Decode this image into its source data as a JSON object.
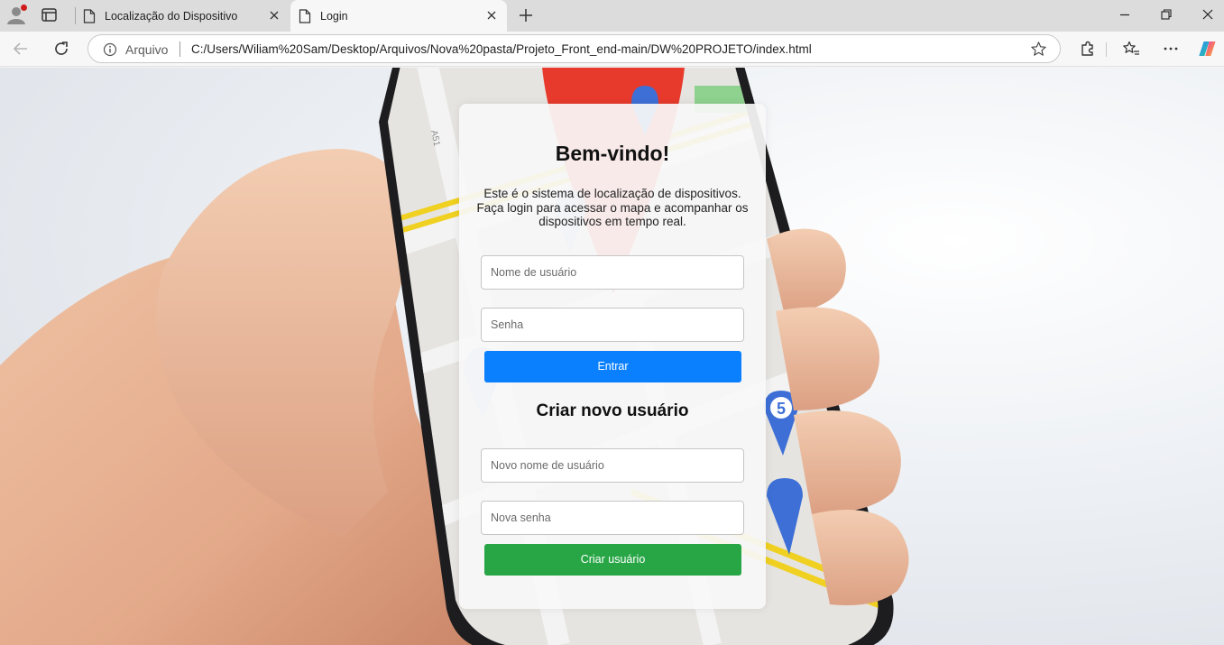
{
  "browser": {
    "tabs": [
      {
        "title": "Localização do Dispositivo",
        "active": false
      },
      {
        "title": "Login",
        "active": true
      }
    ],
    "address": {
      "scheme_label": "Arquivo",
      "url": "C:/Users/Wiliam%20Sam/Desktop/Arquivos/Nova%20pasta/Projeto_Front_end-main/DW%20PROJETO/index.html"
    },
    "icons": {
      "profile": "profile-icon",
      "tab_actions": "tab-actions-icon",
      "page": "page-icon",
      "close": "close-icon",
      "new_tab": "plus-icon",
      "back": "back-arrow-icon",
      "reload": "reload-icon",
      "info": "info-icon",
      "favorite": "star-icon",
      "extensions": "puzzle-icon",
      "favorites": "favorites-icon",
      "menu": "more-icon",
      "copilot": "copilot-icon"
    }
  },
  "login": {
    "title": "Bem-vindo!",
    "intro": "Este é o sistema de localização de dispositivos. Faça login para acessar o mapa e acompanhar os dispositivos em tempo real.",
    "username_placeholder": "Nome de usuário",
    "password_placeholder": "Senha",
    "submit_label": "Entrar"
  },
  "register": {
    "title": "Criar novo usuário",
    "username_placeholder": "Novo nome de usuário",
    "password_placeholder": "Nova senha",
    "submit_label": "Criar usuário"
  },
  "colors": {
    "login_button": "#0a80ff",
    "create_button": "#28a646",
    "map_pin_red": "#e83a2c",
    "map_pin_blue": "#3d6fd6",
    "road_yellow": "#f0d020"
  },
  "background": {
    "map_marker_number": "5"
  }
}
